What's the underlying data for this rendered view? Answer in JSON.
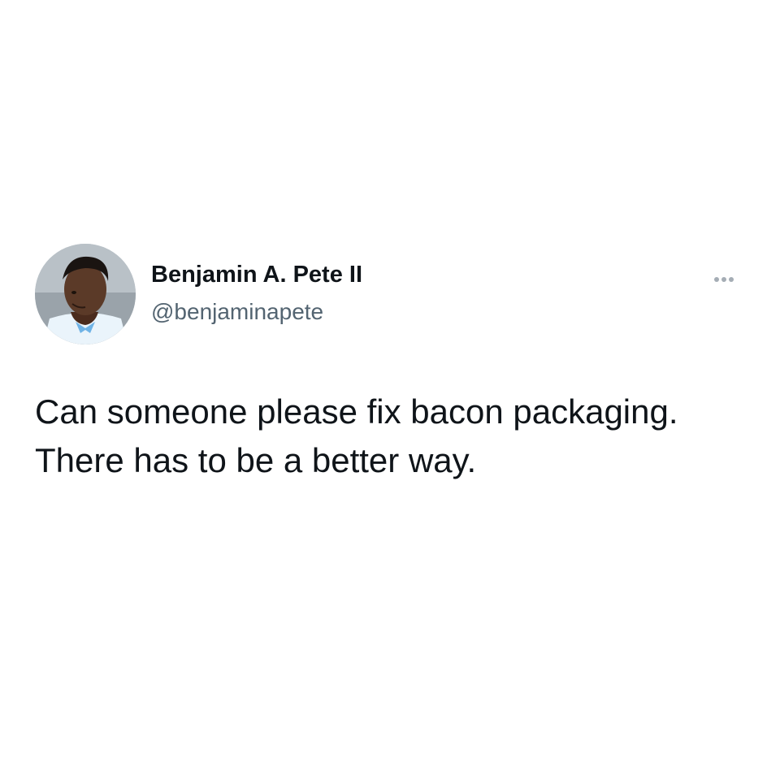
{
  "tweet": {
    "author_name": "Benjamin A. Pete II",
    "author_handle": "@benjaminapete",
    "text": "Can someone please fix bacon packaging. There has to be a better way.",
    "more_icon": "more-horizontal-icon",
    "avatar": "profile-photo"
  },
  "colors": {
    "text": "#0f1419",
    "secondary_text": "#536471",
    "background": "#ffffff"
  }
}
